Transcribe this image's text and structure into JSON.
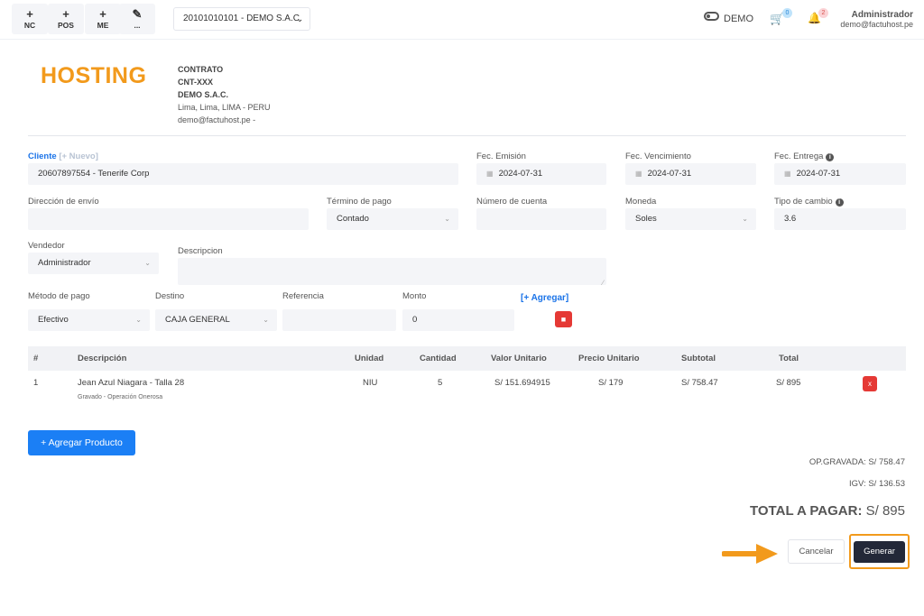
{
  "toolbar": {
    "quick_buttons": [
      {
        "symbol": "+",
        "label": "NC"
      },
      {
        "symbol": "+",
        "label": "POS"
      },
      {
        "symbol": "+",
        "label": "ME"
      },
      {
        "symbol": "✎",
        "label": "..."
      }
    ],
    "company": "20101010101 - DEMO S.A.C.",
    "mode_label": "DEMO",
    "cart_count": "0",
    "notif_count": "2",
    "user_name": "Administrador",
    "user_email": "demo@factuhost.pe"
  },
  "header": {
    "logo_text": "HOSTING",
    "contract_lines": [
      "CONTRATO",
      "CNT-XXX",
      "DEMO S.A.C.",
      "Lima, Lima, LIMA - PERU",
      "demo@factuhost.pe -"
    ]
  },
  "form": {
    "cliente_label": "Cliente",
    "nuevo_link": "[+ Nuevo]",
    "cliente_value": "20607897554 - Tenerife Corp",
    "fec_emision_label": "Fec. Emisión",
    "fec_emision_value": "2024-07-31",
    "fec_vencimiento_label": "Fec. Vencimiento",
    "fec_vencimiento_value": "2024-07-31",
    "fec_entrega_label": "Fec. Entrega",
    "fec_entrega_value": "2024-07-31",
    "direccion_label": "Dirección de envío",
    "direccion_value": "",
    "termino_label": "Término de pago",
    "termino_value": "Contado",
    "cuenta_label": "Número de cuenta",
    "cuenta_value": "",
    "moneda_label": "Moneda",
    "moneda_value": "Soles",
    "tipo_cambio_label": "Tipo de cambio",
    "tipo_cambio_value": "3.6",
    "vendedor_label": "Vendedor",
    "vendedor_value": "Administrador",
    "descripcion_label": "Descripcion",
    "descripcion_value": "",
    "metodo_label": "Método de pago",
    "metodo_value": "Efectivo",
    "destino_label": "Destino",
    "destino_value": "CAJA GENERAL",
    "referencia_label": "Referencia",
    "referencia_value": "",
    "monto_label": "Monto",
    "monto_value": "0",
    "agregar_link": "[+ Agregar]"
  },
  "table": {
    "headers": [
      "#",
      "Descripción",
      "Unidad",
      "Cantidad",
      "Valor Unitario",
      "Precio Unitario",
      "Subtotal",
      "Total"
    ],
    "rows": [
      {
        "num": "1",
        "descripcion": "Jean Azul Niagara - Talla 28",
        "sub": "Gravado - Operación Onerosa",
        "unidad": "NIU",
        "cantidad": "5",
        "valor_unitario": "S/ 151.694915",
        "precio_unitario": "S/ 179",
        "subtotal": "S/ 758.47",
        "total": "S/ 895",
        "delete": "x"
      }
    ]
  },
  "actions": {
    "add_product": "+ Agregar Producto",
    "cancel": "Cancelar",
    "generate": "Generar"
  },
  "totals": {
    "op_gravada": "OP.GRAVADA: S/ 758.47",
    "igv": "IGV: S/ 136.53",
    "total_label": "TOTAL A PAGAR:",
    "total_value": "S/ 895"
  },
  "colors": {
    "accent": "#1b7ff5",
    "brand": "#f29a1c",
    "danger": "#e53935",
    "primary_dark": "#232838"
  }
}
